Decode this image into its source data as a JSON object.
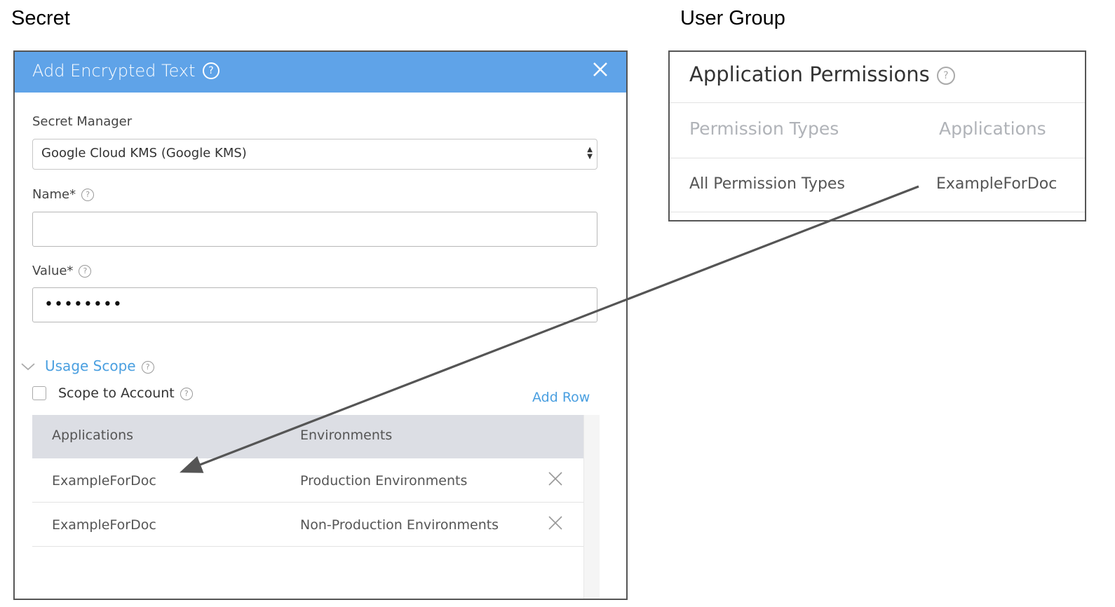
{
  "sections": {
    "secret_title": "Secret",
    "user_group_title": "User Group"
  },
  "dialog": {
    "title": "Add Encrypted Text",
    "header_color": "#5fa3e8",
    "icons": {
      "help": "help-circle-icon",
      "close": "close-icon"
    },
    "secret_manager": {
      "label": "Secret Manager",
      "value": "Google Cloud KMS (Google KMS)"
    },
    "name": {
      "label": "Name*",
      "value": ""
    },
    "value": {
      "label": "Value*",
      "value": "••••••••"
    },
    "usage_scope": {
      "label": "Usage Scope",
      "link_color": "#4a9fe0",
      "scope_to_account": {
        "label": "Scope to Account",
        "checked": false
      },
      "add_row_label": "Add Row",
      "columns": [
        "Applications",
        "Environments"
      ],
      "rows": [
        {
          "application": "ExampleForDoc",
          "environment": "Production Environments"
        },
        {
          "application": "ExampleForDoc",
          "environment": "Non-Production Environments"
        }
      ]
    }
  },
  "user_group": {
    "panel_title": "Application Permissions",
    "columns": [
      "Permission Types",
      "Applications"
    ],
    "rows": [
      {
        "permission_type": "All Permission Types",
        "application": "ExampleForDoc"
      }
    ]
  }
}
